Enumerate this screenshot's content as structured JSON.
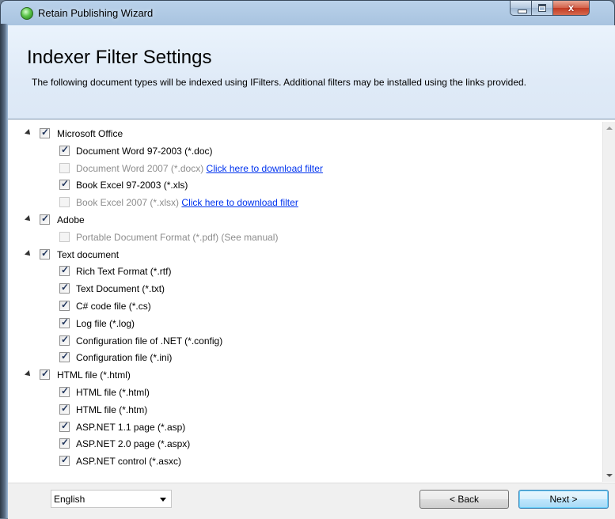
{
  "window": {
    "title": "Retain Publishing Wizard",
    "close_glyph": "x"
  },
  "header": {
    "title": "Indexer Filter Settings",
    "description": "The following document types will be indexed using IFilters. Additional filters may be installed using the links provided."
  },
  "tree": {
    "groups": [
      {
        "label": "Microsoft Office",
        "checked": true,
        "expanded": true,
        "items": [
          {
            "label": "Document Word 97-2003 (*.doc)",
            "checked": true,
            "enabled": true
          },
          {
            "label": "Document Word 2007 (*.docx)",
            "checked": false,
            "enabled": false,
            "link": "Click here to download filter"
          },
          {
            "label": "Book Excel 97-2003 (*.xls)",
            "checked": true,
            "enabled": true
          },
          {
            "label": "Book Excel 2007 (*.xlsx)",
            "checked": false,
            "enabled": false,
            "link": "Click here to download filter"
          }
        ]
      },
      {
        "label": "Adobe",
        "checked": true,
        "expanded": true,
        "items": [
          {
            "label": "Portable Document Format (*.pdf)",
            "checked": false,
            "enabled": false,
            "note": "(See manual)"
          }
        ]
      },
      {
        "label": "Text document",
        "checked": true,
        "expanded": true,
        "items": [
          {
            "label": "Rich Text Format (*.rtf)",
            "checked": true,
            "enabled": true
          },
          {
            "label": "Text Document (*.txt)",
            "checked": true,
            "enabled": true
          },
          {
            "label": "C# code file (*.cs)",
            "checked": true,
            "enabled": true
          },
          {
            "label": "Log file (*.log)",
            "checked": true,
            "enabled": true
          },
          {
            "label": "Configuration file of .NET (*.config)",
            "checked": true,
            "enabled": true
          },
          {
            "label": "Configuration file (*.ini)",
            "checked": true,
            "enabled": true
          }
        ]
      },
      {
        "label": "HTML file (*.html)",
        "checked": true,
        "expanded": true,
        "items": [
          {
            "label": "HTML file (*.html)",
            "checked": true,
            "enabled": true
          },
          {
            "label": "HTML file (*.htm)",
            "checked": true,
            "enabled": true
          },
          {
            "label": "ASP.NET 1.1 page (*.asp)",
            "checked": true,
            "enabled": true
          },
          {
            "label": "ASP.NET 2.0 page (*.aspx)",
            "checked": true,
            "enabled": true
          },
          {
            "label": "ASP.NET control (*.asxc)",
            "checked": true,
            "enabled": true
          }
        ]
      }
    ]
  },
  "footer": {
    "language": "English",
    "back_label": "< Back",
    "next_label": "Next >"
  }
}
